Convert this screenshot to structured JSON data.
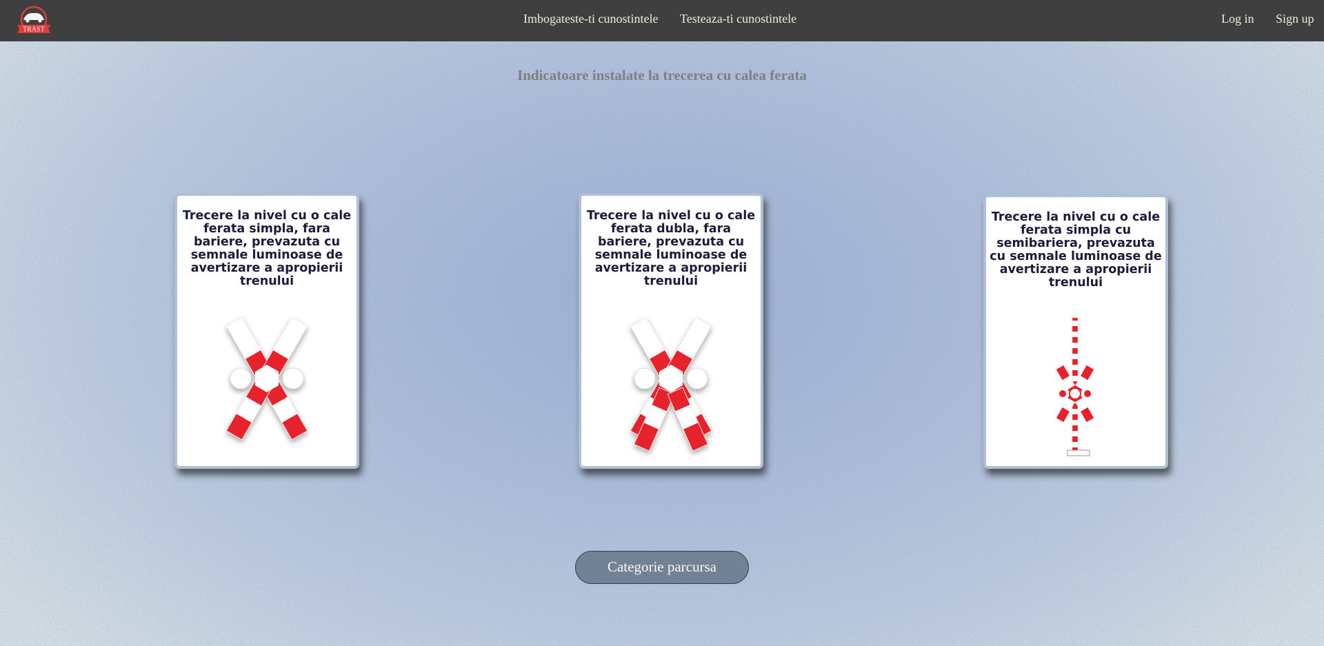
{
  "brand": {
    "logo_text": "TRAST"
  },
  "nav": {
    "learn_label": "Imbogateste-ti cunostintele",
    "test_label": "Testeaza-ti cunostintele",
    "login_label": "Log in",
    "signup_label": "Sign up"
  },
  "page": {
    "title": "Indicatoare instalate la trecerea cu calea ferata"
  },
  "cards": [
    {
      "title": "Trecere la nivel cu o cale ferata simpla, fara bariere, prevazuta cu semnale luminoase de avertizare a apropierii trenului",
      "sign_icon": "single-track-crossbuck-sign"
    },
    {
      "title": "Trecere la nivel cu o cale ferata dubla, fara bariere, prevazuta cu semnale luminoase de avertizare a apropierii trenului",
      "sign_icon": "double-track-crossbuck-sign"
    },
    {
      "title": "Trecere la nivel cu o cale ferata simpla cu semibariera, prevazuta cu semnale luminoase de avertizare a apropierii trenului",
      "sign_icon": "half-barrier-crossing-sign"
    }
  ],
  "footer": {
    "category_button_label": "Categorie parcursa"
  },
  "colors": {
    "navbar": "#3f3f3f",
    "nav_text": "#f3ecd2",
    "title_text": "#7f7f83",
    "card_title_text": "#1c1b3a",
    "sign_red": "#e8202a",
    "button_bg": "#728295"
  }
}
